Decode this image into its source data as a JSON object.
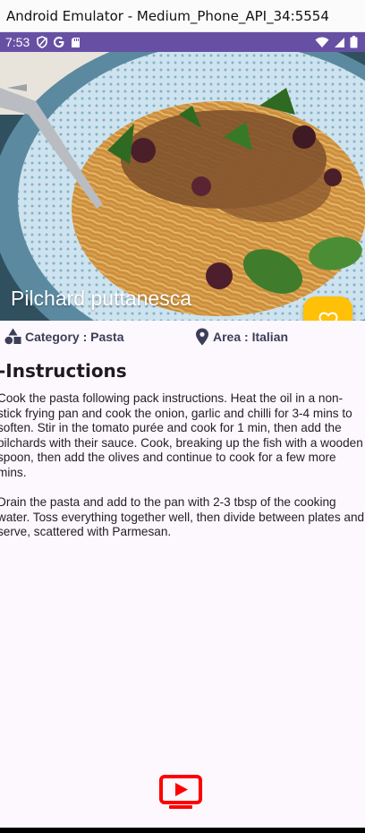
{
  "window": {
    "title": "Android Emulator - Medium_Phone_API_34:5554"
  },
  "status_bar": {
    "time": "7:53",
    "left_icons": [
      "shield-icon",
      "google-icon",
      "sd-card-icon"
    ],
    "right_icons": [
      "wifi-icon",
      "signal-icon",
      "battery-icon"
    ],
    "color": "#6750a4"
  },
  "meal": {
    "name": "Pilchard puttanesca",
    "category": "Category : Pasta",
    "area": "Area : Italian"
  },
  "instructions": {
    "heading": "-Instructions",
    "text": "Cook the pasta following pack instructions. Heat the oil in a non-stick frying pan and cook the onion, garlic and chilli for 3-4 mins to soften. Stir in the tomato purée and cook for 1 min, then add the pilchards with their sauce. Cook, breaking up the fish with a wooden spoon, then add the olives and continue to cook for a few more mins.\n\nDrain the pasta and add to the pan with 2-3 tbsp of the cooking water. Toss everything together well, then divide between plates and serve, scattered with Parmesan."
  },
  "favorite_button": {
    "icon": "heart-outline-icon",
    "color": "#ffc107"
  },
  "youtube_button": {
    "icon": "youtube-play-icon",
    "color": "#ff0000"
  },
  "colors": {
    "background": "#fdf7fe",
    "meta_text": "#3b3f58"
  }
}
